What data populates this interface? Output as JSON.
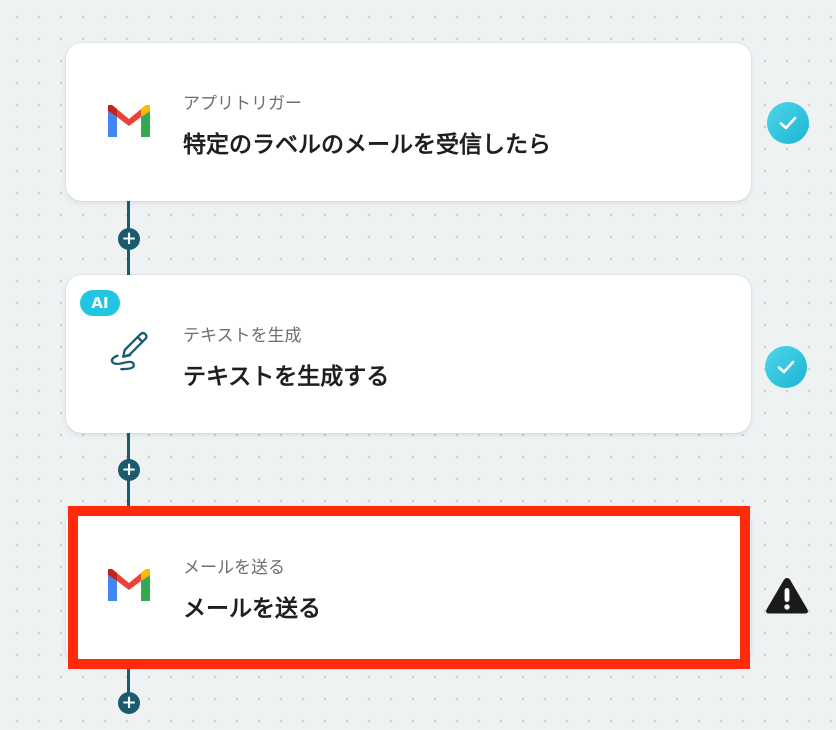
{
  "flow": {
    "steps": [
      {
        "subtitle": "アプリトリガー",
        "title": "特定のラベルのメールを受信したら",
        "icon": "gmail-icon",
        "status": "complete"
      },
      {
        "badge": "AI",
        "subtitle": "テキストを生成",
        "title": "テキストを生成する",
        "icon": "pen-icon",
        "status": "complete"
      },
      {
        "subtitle": "メールを送る",
        "title": "メールを送る",
        "icon": "gmail-icon",
        "status": "warning",
        "highlighted": true
      }
    ],
    "add_step_symbol": "+"
  },
  "colors": {
    "connector": "#1b5b6e",
    "check": "#1bb4d1",
    "ai_badge": "#23c6e0",
    "highlight": "#ff2a0a",
    "warning": "#1a1a1a"
  }
}
